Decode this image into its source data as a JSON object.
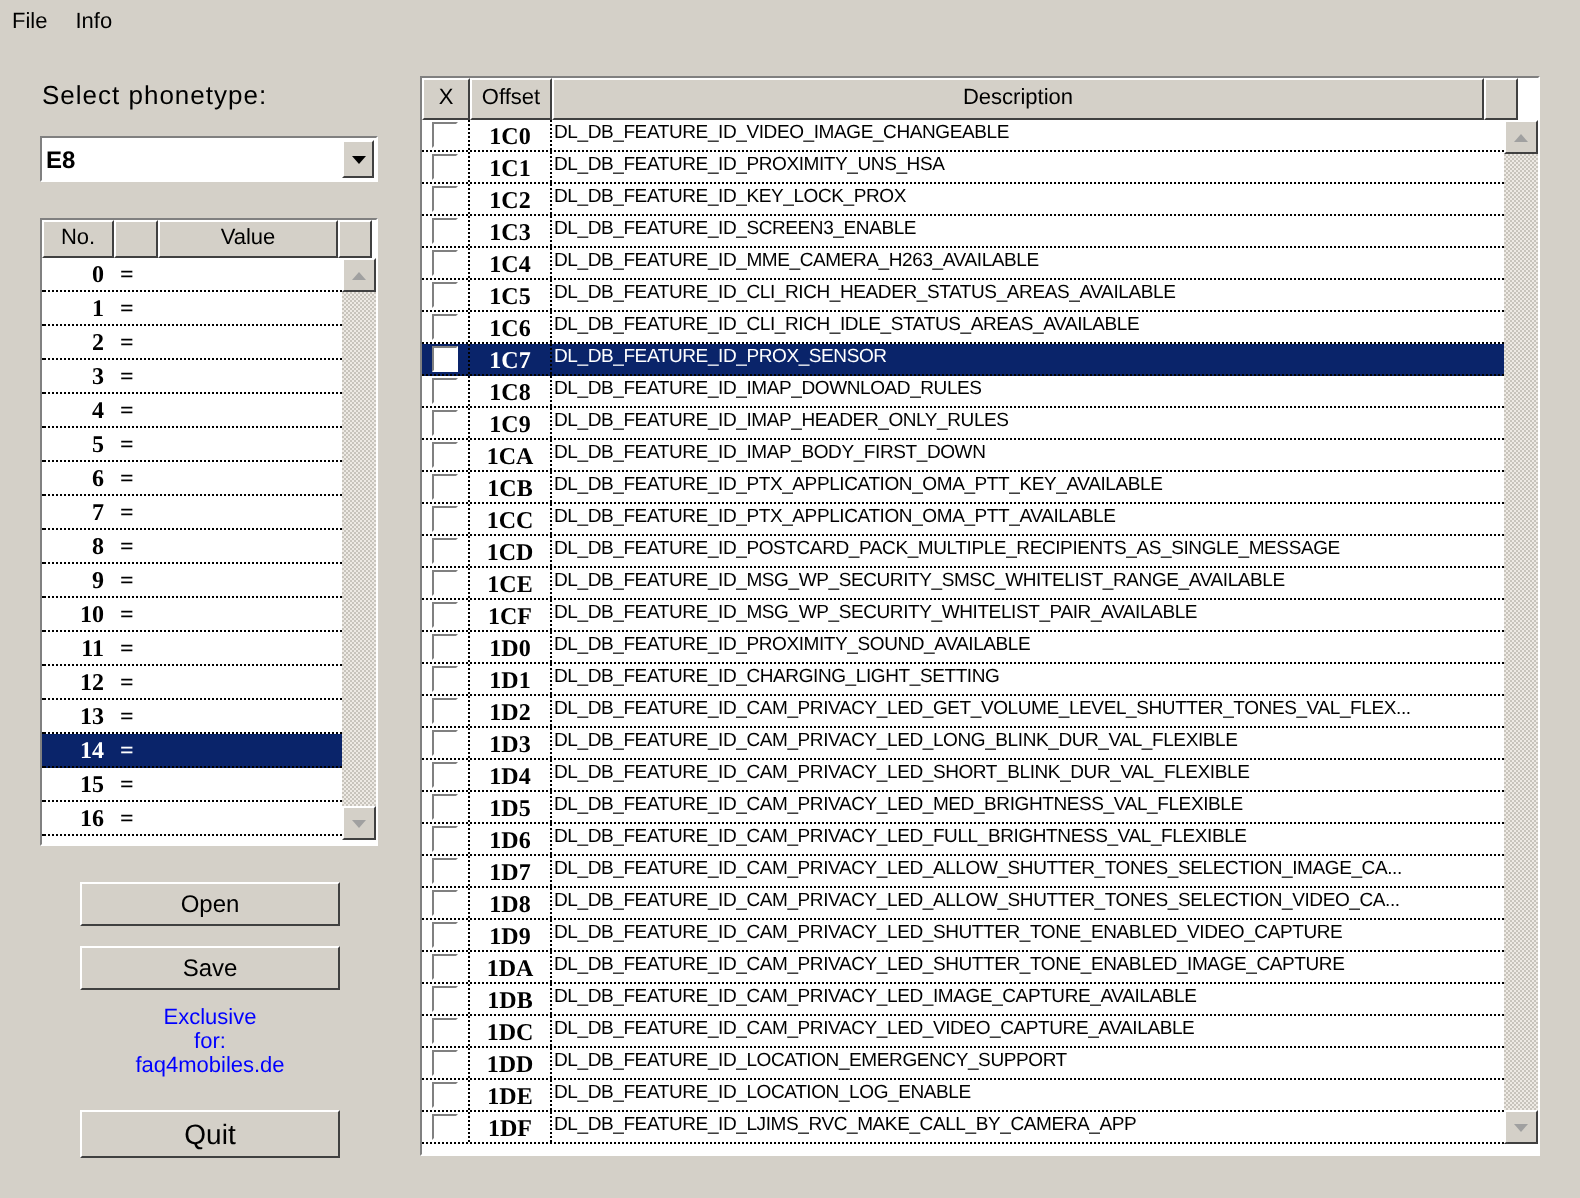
{
  "menu": [
    "File",
    "Info"
  ],
  "phonetype": {
    "label": "Select phonetype:",
    "value": "E8"
  },
  "value_list": {
    "columns": [
      "No.",
      "",
      "Value",
      ""
    ],
    "rows": [
      {
        "no": "0",
        "eq": "=",
        "selected": false
      },
      {
        "no": "1",
        "eq": "=",
        "selected": false
      },
      {
        "no": "2",
        "eq": "=",
        "selected": false
      },
      {
        "no": "3",
        "eq": "=",
        "selected": false
      },
      {
        "no": "4",
        "eq": "=",
        "selected": false
      },
      {
        "no": "5",
        "eq": "=",
        "selected": false
      },
      {
        "no": "6",
        "eq": "=",
        "selected": false
      },
      {
        "no": "7",
        "eq": "=",
        "selected": false
      },
      {
        "no": "8",
        "eq": "=",
        "selected": false
      },
      {
        "no": "9",
        "eq": "=",
        "selected": false
      },
      {
        "no": "10",
        "eq": "=",
        "selected": false
      },
      {
        "no": "11",
        "eq": "=",
        "selected": false
      },
      {
        "no": "12",
        "eq": "=",
        "selected": false
      },
      {
        "no": "13",
        "eq": "=",
        "selected": false
      },
      {
        "no": "14",
        "eq": "=",
        "selected": true
      },
      {
        "no": "15",
        "eq": "=",
        "selected": false
      },
      {
        "no": "16",
        "eq": "=",
        "selected": false
      }
    ]
  },
  "buttons": {
    "open": "Open",
    "save": "Save",
    "quit": "Quit"
  },
  "exclusive": [
    "Exclusive",
    "for:",
    "faq4mobiles.de"
  ],
  "table": {
    "columns": [
      "X",
      "Offset",
      "Description"
    ],
    "rows": [
      {
        "checked": false,
        "selected": false,
        "offset": "1C0",
        "description": "DL_DB_FEATURE_ID_VIDEO_IMAGE_CHANGEABLE"
      },
      {
        "checked": false,
        "selected": false,
        "offset": "1C1",
        "description": "DL_DB_FEATURE_ID_PROXIMITY_UNS_HSA"
      },
      {
        "checked": false,
        "selected": false,
        "offset": "1C2",
        "description": "DL_DB_FEATURE_ID_KEY_LOCK_PROX"
      },
      {
        "checked": false,
        "selected": false,
        "offset": "1C3",
        "description": "DL_DB_FEATURE_ID_SCREEN3_ENABLE"
      },
      {
        "checked": false,
        "selected": false,
        "offset": "1C4",
        "description": "DL_DB_FEATURE_ID_MME_CAMERA_H263_AVAILABLE"
      },
      {
        "checked": false,
        "selected": false,
        "offset": "1C5",
        "description": "DL_DB_FEATURE_ID_CLI_RICH_HEADER_STATUS_AREAS_AVAILABLE"
      },
      {
        "checked": false,
        "selected": false,
        "offset": "1C6",
        "description": "DL_DB_FEATURE_ID_CLI_RICH_IDLE_STATUS_AREAS_AVAILABLE"
      },
      {
        "checked": false,
        "selected": true,
        "offset": "1C7",
        "description": "DL_DB_FEATURE_ID_PROX_SENSOR"
      },
      {
        "checked": false,
        "selected": false,
        "offset": "1C8",
        "description": "DL_DB_FEATURE_ID_IMAP_DOWNLOAD_RULES"
      },
      {
        "checked": false,
        "selected": false,
        "offset": "1C9",
        "description": "DL_DB_FEATURE_ID_IMAP_HEADER_ONLY_RULES"
      },
      {
        "checked": false,
        "selected": false,
        "offset": "1CA",
        "description": "DL_DB_FEATURE_ID_IMAP_BODY_FIRST_DOWN"
      },
      {
        "checked": false,
        "selected": false,
        "offset": "1CB",
        "description": "DL_DB_FEATURE_ID_PTX_APPLICATION_OMA_PTT_KEY_AVAILABLE"
      },
      {
        "checked": false,
        "selected": false,
        "offset": "1CC",
        "description": "DL_DB_FEATURE_ID_PTX_APPLICATION_OMA_PTT_AVAILABLE"
      },
      {
        "checked": false,
        "selected": false,
        "offset": "1CD",
        "description": "DL_DB_FEATURE_ID_POSTCARD_PACK_MULTIPLE_RECIPIENTS_AS_SINGLE_MESSAGE"
      },
      {
        "checked": false,
        "selected": false,
        "offset": "1CE",
        "description": "DL_DB_FEATURE_ID_MSG_WP_SECURITY_SMSC_WHITELIST_RANGE_AVAILABLE"
      },
      {
        "checked": false,
        "selected": false,
        "offset": "1CF",
        "description": "DL_DB_FEATURE_ID_MSG_WP_SECURITY_WHITELIST_PAIR_AVAILABLE"
      },
      {
        "checked": false,
        "selected": false,
        "offset": "1D0",
        "description": "DL_DB_FEATURE_ID_PROXIMITY_SOUND_AVAILABLE"
      },
      {
        "checked": false,
        "selected": false,
        "offset": "1D1",
        "description": "DL_DB_FEATURE_ID_CHARGING_LIGHT_SETTING"
      },
      {
        "checked": false,
        "selected": false,
        "offset": "1D2",
        "description": "DL_DB_FEATURE_ID_CAM_PRIVACY_LED_GET_VOLUME_LEVEL_SHUTTER_TONES_VAL_FLEX..."
      },
      {
        "checked": false,
        "selected": false,
        "offset": "1D3",
        "description": "DL_DB_FEATURE_ID_CAM_PRIVACY_LED_LONG_BLINK_DUR_VAL_FLEXIBLE"
      },
      {
        "checked": false,
        "selected": false,
        "offset": "1D4",
        "description": "DL_DB_FEATURE_ID_CAM_PRIVACY_LED_SHORT_BLINK_DUR_VAL_FLEXIBLE"
      },
      {
        "checked": false,
        "selected": false,
        "offset": "1D5",
        "description": "DL_DB_FEATURE_ID_CAM_PRIVACY_LED_MED_BRIGHTNESS_VAL_FLEXIBLE"
      },
      {
        "checked": false,
        "selected": false,
        "offset": "1D6",
        "description": "DL_DB_FEATURE_ID_CAM_PRIVACY_LED_FULL_BRIGHTNESS_VAL_FLEXIBLE"
      },
      {
        "checked": false,
        "selected": false,
        "offset": "1D7",
        "description": "DL_DB_FEATURE_ID_CAM_PRIVACY_LED_ALLOW_SHUTTER_TONES_SELECTION_IMAGE_CA..."
      },
      {
        "checked": false,
        "selected": false,
        "offset": "1D8",
        "description": "DL_DB_FEATURE_ID_CAM_PRIVACY_LED_ALLOW_SHUTTER_TONES_SELECTION_VIDEO_CA..."
      },
      {
        "checked": false,
        "selected": false,
        "offset": "1D9",
        "description": "DL_DB_FEATURE_ID_CAM_PRIVACY_LED_SHUTTER_TONE_ENABLED_VIDEO_CAPTURE"
      },
      {
        "checked": false,
        "selected": false,
        "offset": "1DA",
        "description": "DL_DB_FEATURE_ID_CAM_PRIVACY_LED_SHUTTER_TONE_ENABLED_IMAGE_CAPTURE"
      },
      {
        "checked": false,
        "selected": false,
        "offset": "1DB",
        "description": "DL_DB_FEATURE_ID_CAM_PRIVACY_LED_IMAGE_CAPTURE_AVAILABLE"
      },
      {
        "checked": false,
        "selected": false,
        "offset": "1DC",
        "description": "DL_DB_FEATURE_ID_CAM_PRIVACY_LED_VIDEO_CAPTURE_AVAILABLE"
      },
      {
        "checked": false,
        "selected": false,
        "offset": "1DD",
        "description": "DL_DB_FEATURE_ID_LOCATION_EMERGENCY_SUPPORT"
      },
      {
        "checked": false,
        "selected": false,
        "offset": "1DE",
        "description": "DL_DB_FEATURE_ID_LOCATION_LOG_ENABLE"
      },
      {
        "checked": false,
        "selected": false,
        "offset": "1DF",
        "description": "DL_DB_FEATURE_ID_LJIMS_RVC_MAKE_CALL_BY_CAMERA_APP"
      }
    ]
  }
}
